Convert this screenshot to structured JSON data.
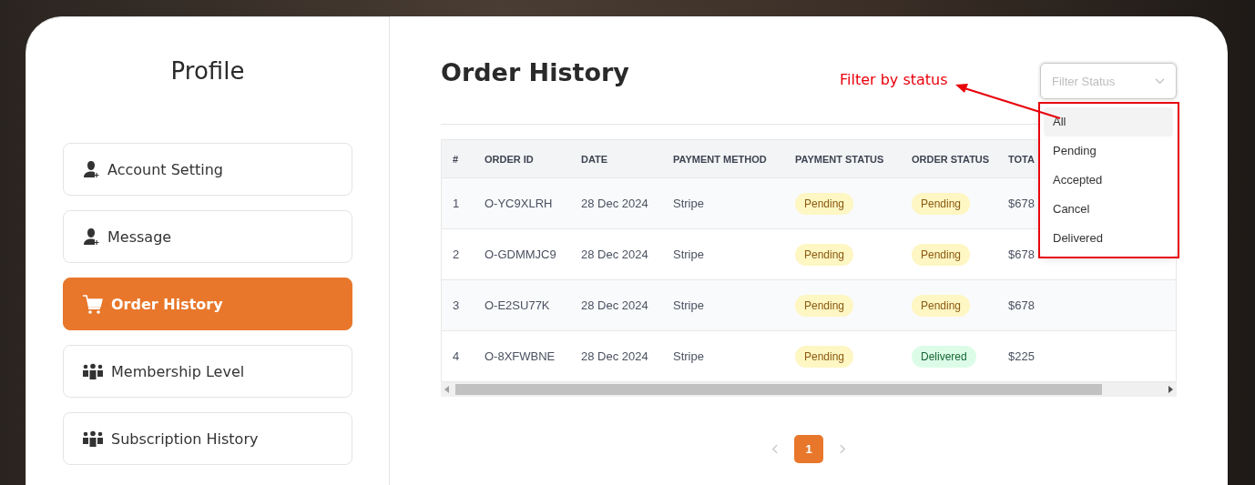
{
  "sidebar": {
    "title": "Profile",
    "items": [
      {
        "label": "Account Setting",
        "kind": "user",
        "selected": false
      },
      {
        "label": "Message",
        "kind": "user",
        "selected": false
      },
      {
        "label": "Order History",
        "kind": "cart",
        "selected": true
      },
      {
        "label": "Membership Level",
        "kind": "group",
        "selected": false
      },
      {
        "label": "Subscription History",
        "kind": "group",
        "selected": false
      }
    ]
  },
  "main": {
    "title": "Order History",
    "filter": {
      "placeholder": "Filter Status",
      "expanded": true,
      "options": [
        {
          "label": "All",
          "selected": true
        },
        {
          "label": "Pending",
          "selected": false
        },
        {
          "label": "Accepted",
          "selected": false
        },
        {
          "label": "Cancel",
          "selected": false
        },
        {
          "label": "Delivered",
          "selected": false
        }
      ]
    },
    "annotation": {
      "label": "Filter by status"
    },
    "table": {
      "columns": [
        "#",
        "ORDER ID",
        "DATE",
        "PAYMENT METHOD",
        "PAYMENT STATUS",
        "ORDER STATUS",
        "TOTA"
      ],
      "rows": [
        {
          "num": "1",
          "order_id": "O-YC9XLRH",
          "date": "28 Dec 2024",
          "payment_method": "Stripe",
          "payment_status": {
            "label": "Pending",
            "kind": "pending"
          },
          "order_status": {
            "label": "Pending",
            "kind": "pending"
          },
          "total": "$678"
        },
        {
          "num": "2",
          "order_id": "O-GDMMJC9",
          "date": "28 Dec 2024",
          "payment_method": "Stripe",
          "payment_status": {
            "label": "Pending",
            "kind": "pending"
          },
          "order_status": {
            "label": "Pending",
            "kind": "pending"
          },
          "total": "$678"
        },
        {
          "num": "3",
          "order_id": "O-E2SU77K",
          "date": "28 Dec 2024",
          "payment_method": "Stripe",
          "payment_status": {
            "label": "Pending",
            "kind": "pending"
          },
          "order_status": {
            "label": "Pending",
            "kind": "pending"
          },
          "total": "$678"
        },
        {
          "num": "4",
          "order_id": "O-8XFWBNE",
          "date": "28 Dec 2024",
          "payment_method": "Stripe",
          "payment_status": {
            "label": "Pending",
            "kind": "pending"
          },
          "order_status": {
            "label": "Delivered",
            "kind": "delivered"
          },
          "total": "$225"
        }
      ]
    },
    "pagination": {
      "pages": [
        {
          "label": "1",
          "selected": true
        }
      ]
    }
  }
}
